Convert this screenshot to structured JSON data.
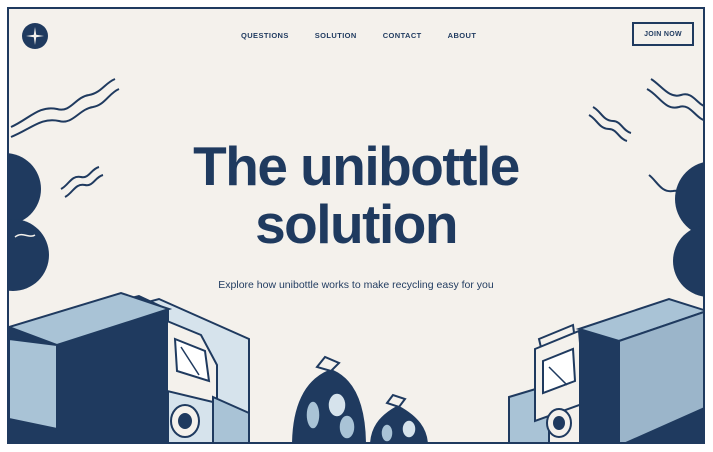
{
  "nav": {
    "items": [
      {
        "label": "QUESTIONS"
      },
      {
        "label": "SOLUTION"
      },
      {
        "label": "CONTACT"
      },
      {
        "label": "ABOUT"
      }
    ],
    "cta_label": "JOIN NOW"
  },
  "hero": {
    "title_line1": "The unibottle",
    "title_line2": "solution",
    "subtitle": "Explore how unibottle works to make recycling easy for you"
  },
  "icons": {
    "logo": "compass-star-icon"
  },
  "colors": {
    "navy": "#1f3a5f",
    "background": "#f4f1ec",
    "light_blue": "#a9c3d6",
    "pale_blue": "#d6e3ec"
  }
}
